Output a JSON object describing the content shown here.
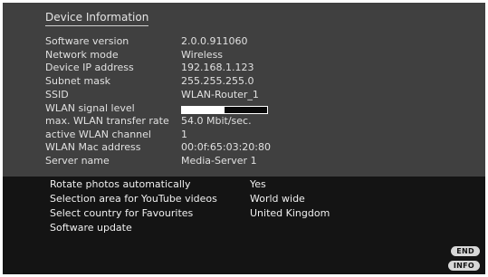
{
  "panel": {
    "title": "Device Information",
    "rows": [
      {
        "label": "Software version",
        "value": "2.0.0.911060"
      },
      {
        "label": "Network mode",
        "value": "Wireless"
      },
      {
        "label": "Device IP address",
        "value": "192.168.1.123"
      },
      {
        "label": "Subnet mask",
        "value": "255.255.255.0"
      },
      {
        "label": "SSID",
        "value": "WLAN-Router_1"
      },
      {
        "label": "WLAN signal level",
        "signal_level": 0.5
      },
      {
        "label": "max. WLAN transfer rate",
        "value": "54.0 Mbit/sec."
      },
      {
        "label": "active WLAN channel",
        "value": "1"
      },
      {
        "label": "WLAN Mac address",
        "value": "00:0f:65:03:20:80"
      },
      {
        "label": "Server name",
        "value": "Media-Server 1"
      }
    ]
  },
  "settings": [
    {
      "label": "Rotate photos automatically",
      "value": "Yes"
    },
    {
      "label": "Selection area for YouTube videos",
      "value": "World wide"
    },
    {
      "label": "Select country for Favourites",
      "value": "United Kingdom"
    },
    {
      "label": "Software update",
      "value": ""
    }
  ],
  "buttons": {
    "end": "END",
    "info": "INFO"
  },
  "colors": {
    "panel_bg": "#404040",
    "screen_bg": "#141414",
    "text": "#e0e0e0"
  }
}
